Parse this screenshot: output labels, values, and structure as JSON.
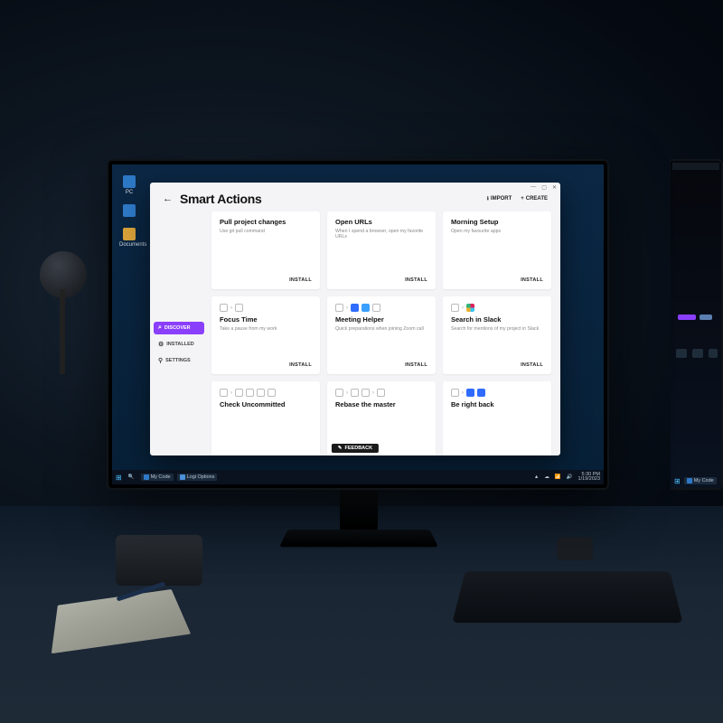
{
  "desktop": {
    "icons": [
      {
        "label": "PC",
        "color": "#2e79c7"
      },
      {
        "label": "",
        "color": "#2e79c7"
      },
      {
        "label": "Documents",
        "color": "#d9a23a"
      }
    ]
  },
  "taskbar": {
    "apps": [
      {
        "label": "My Code",
        "color": "#2e79c7"
      },
      {
        "label": "Logi Options",
        "color": "#4a90d9"
      }
    ],
    "time": "5:30 PM",
    "date": "1/19/2023"
  },
  "second_taskbar": {
    "apps": [
      {
        "label": "My Code"
      }
    ]
  },
  "app": {
    "title": "Smart Actions",
    "header_actions": {
      "import": "IMPORT",
      "create": "CREATE"
    },
    "sidebar": {
      "items": [
        {
          "label": "DISCOVER",
          "active": true,
          "icon": "search"
        },
        {
          "label": "INSTALLED",
          "active": false,
          "icon": "installed"
        },
        {
          "label": "SETTINGS",
          "active": false,
          "icon": "settings"
        }
      ]
    },
    "cards": [
      {
        "title": "Pull project changes",
        "desc": "Use git pull command",
        "action": "INSTALL",
        "icons": []
      },
      {
        "title": "Open URLs",
        "desc": "When I spend a browser, open my favorite URLs",
        "action": "INSTALL",
        "icons": []
      },
      {
        "title": "Morning Setup",
        "desc": "Open my favourite apps",
        "action": "INSTALL",
        "icons": []
      },
      {
        "title": "Focus Time",
        "desc": "Take a pause from my work",
        "action": "INSTALL",
        "icons": [
          "outline",
          "arrow",
          "outline"
        ]
      },
      {
        "title": "Meeting Helper",
        "desc": "Quick preparations when joining Zoom call",
        "action": "INSTALL",
        "icons": [
          "outline",
          "arrow",
          "blue",
          "sky",
          "outline"
        ]
      },
      {
        "title": "Search in Slack",
        "desc": "Search for mentions of my project in Slack",
        "action": "INSTALL",
        "icons": [
          "outline",
          "arrow",
          "slack"
        ]
      },
      {
        "title": "Check Uncommitted",
        "desc": "",
        "action": "",
        "icons": [
          "outline",
          "arrow",
          "outline",
          "outline",
          "outline",
          "outline"
        ]
      },
      {
        "title": "Rebase the master",
        "desc": "",
        "action": "",
        "icons": [
          "outline",
          "arrow",
          "outline",
          "outline",
          "arrow",
          "outline"
        ]
      },
      {
        "title": "Be right back",
        "desc": "",
        "action": "",
        "icons": [
          "outline",
          "arrow",
          "blue",
          "blue"
        ]
      }
    ],
    "feedback": "FEEDBACK"
  }
}
